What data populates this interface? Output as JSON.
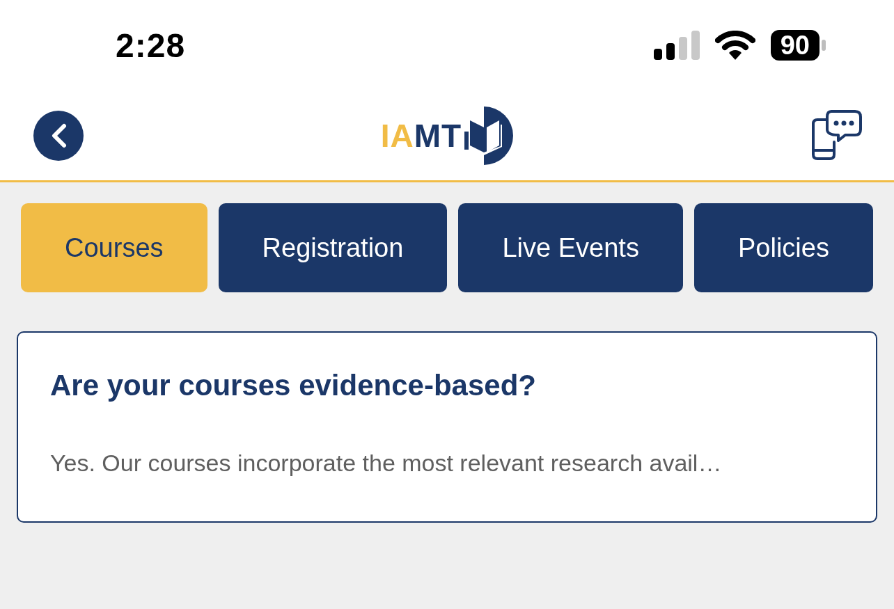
{
  "status_bar": {
    "time": "2:28",
    "battery": "90"
  },
  "header": {
    "logo": "IAMT"
  },
  "tabs": [
    {
      "label": "Courses",
      "selected": true
    },
    {
      "label": "Registration",
      "selected": false
    },
    {
      "label": "Live Events",
      "selected": false
    },
    {
      "label": "Policies",
      "selected": false
    }
  ],
  "faq": [
    {
      "question": "Are your courses evidence-based?",
      "answer": "Yes. Our courses incorporate the most relevant research avail…"
    }
  ]
}
